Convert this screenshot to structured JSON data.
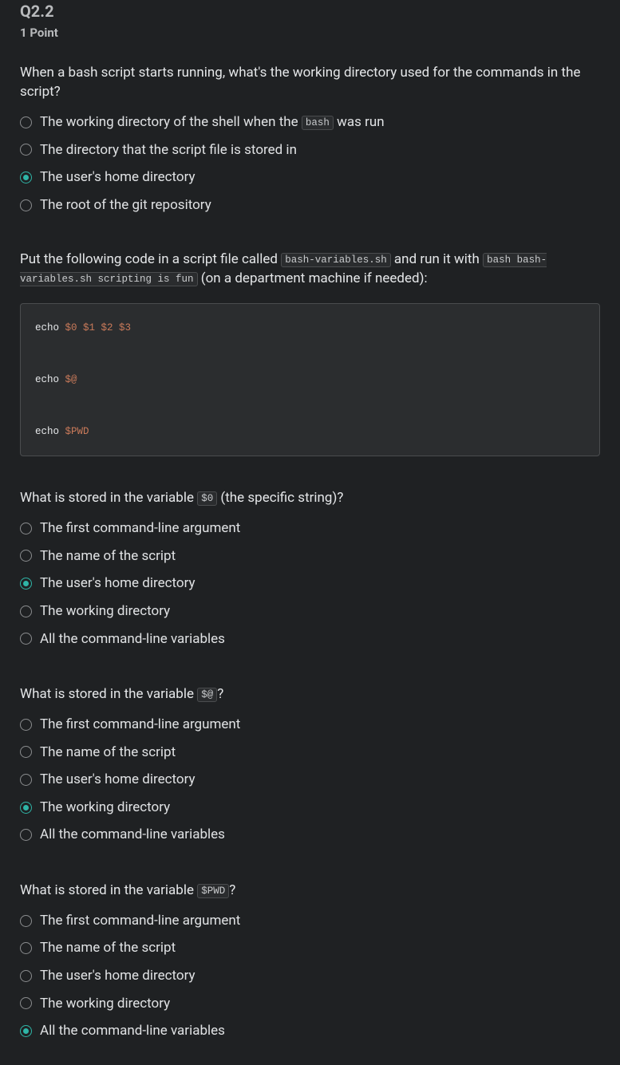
{
  "header": {
    "number": "Q2.2",
    "points": "1 Point"
  },
  "q1": {
    "prompt_pre": "When a bash script starts running, what's the working directory used for the commands in the script?",
    "options": [
      {
        "pre": "The working directory of the shell when the ",
        "code": "bash",
        "post": " was run",
        "selected": false
      },
      {
        "text": "The directory that the script file is stored in",
        "selected": false
      },
      {
        "text": "The user's home directory",
        "selected": true
      },
      {
        "text": "The root of the git repository",
        "selected": false
      }
    ]
  },
  "instr": {
    "pre1": "Put the following code in a script file called ",
    "code1": "bash-variables.sh",
    "mid": " and run it with ",
    "code2": "bash bash-variables.sh scripting is fun",
    "post": " (on a department machine if needed):"
  },
  "codeblock": {
    "l1a": "echo ",
    "l1b": "$0 $1 $2 $3",
    "l2a": "echo ",
    "l2b": "$@",
    "l3a": "echo ",
    "l3b": "$PWD"
  },
  "q2": {
    "pre": "What is stored in the variable ",
    "code": "$0",
    "post": " (the specific string)?",
    "options": [
      {
        "text": "The first command-line argument",
        "selected": false
      },
      {
        "text": "The name of the script",
        "selected": false
      },
      {
        "text": "The user's home directory",
        "selected": true
      },
      {
        "text": "The working directory",
        "selected": false
      },
      {
        "text": "All the command-line variables",
        "selected": false
      }
    ]
  },
  "q3": {
    "pre": "What is stored in the variable ",
    "code": "$@",
    "post": "?",
    "options": [
      {
        "text": "The first command-line argument",
        "selected": false
      },
      {
        "text": "The name of the script",
        "selected": false
      },
      {
        "text": "The user's home directory",
        "selected": false
      },
      {
        "text": "The working directory",
        "selected": true
      },
      {
        "text": "All the command-line variables",
        "selected": false
      }
    ]
  },
  "q4": {
    "pre": "What is stored in the variable ",
    "code": "$PWD",
    "post": "?",
    "options": [
      {
        "text": "The first command-line argument",
        "selected": false
      },
      {
        "text": "The name of the script",
        "selected": false
      },
      {
        "text": "The user's home directory",
        "selected": false
      },
      {
        "text": "The working directory",
        "selected": false
      },
      {
        "text": "All the command-line variables",
        "selected": true
      }
    ]
  }
}
